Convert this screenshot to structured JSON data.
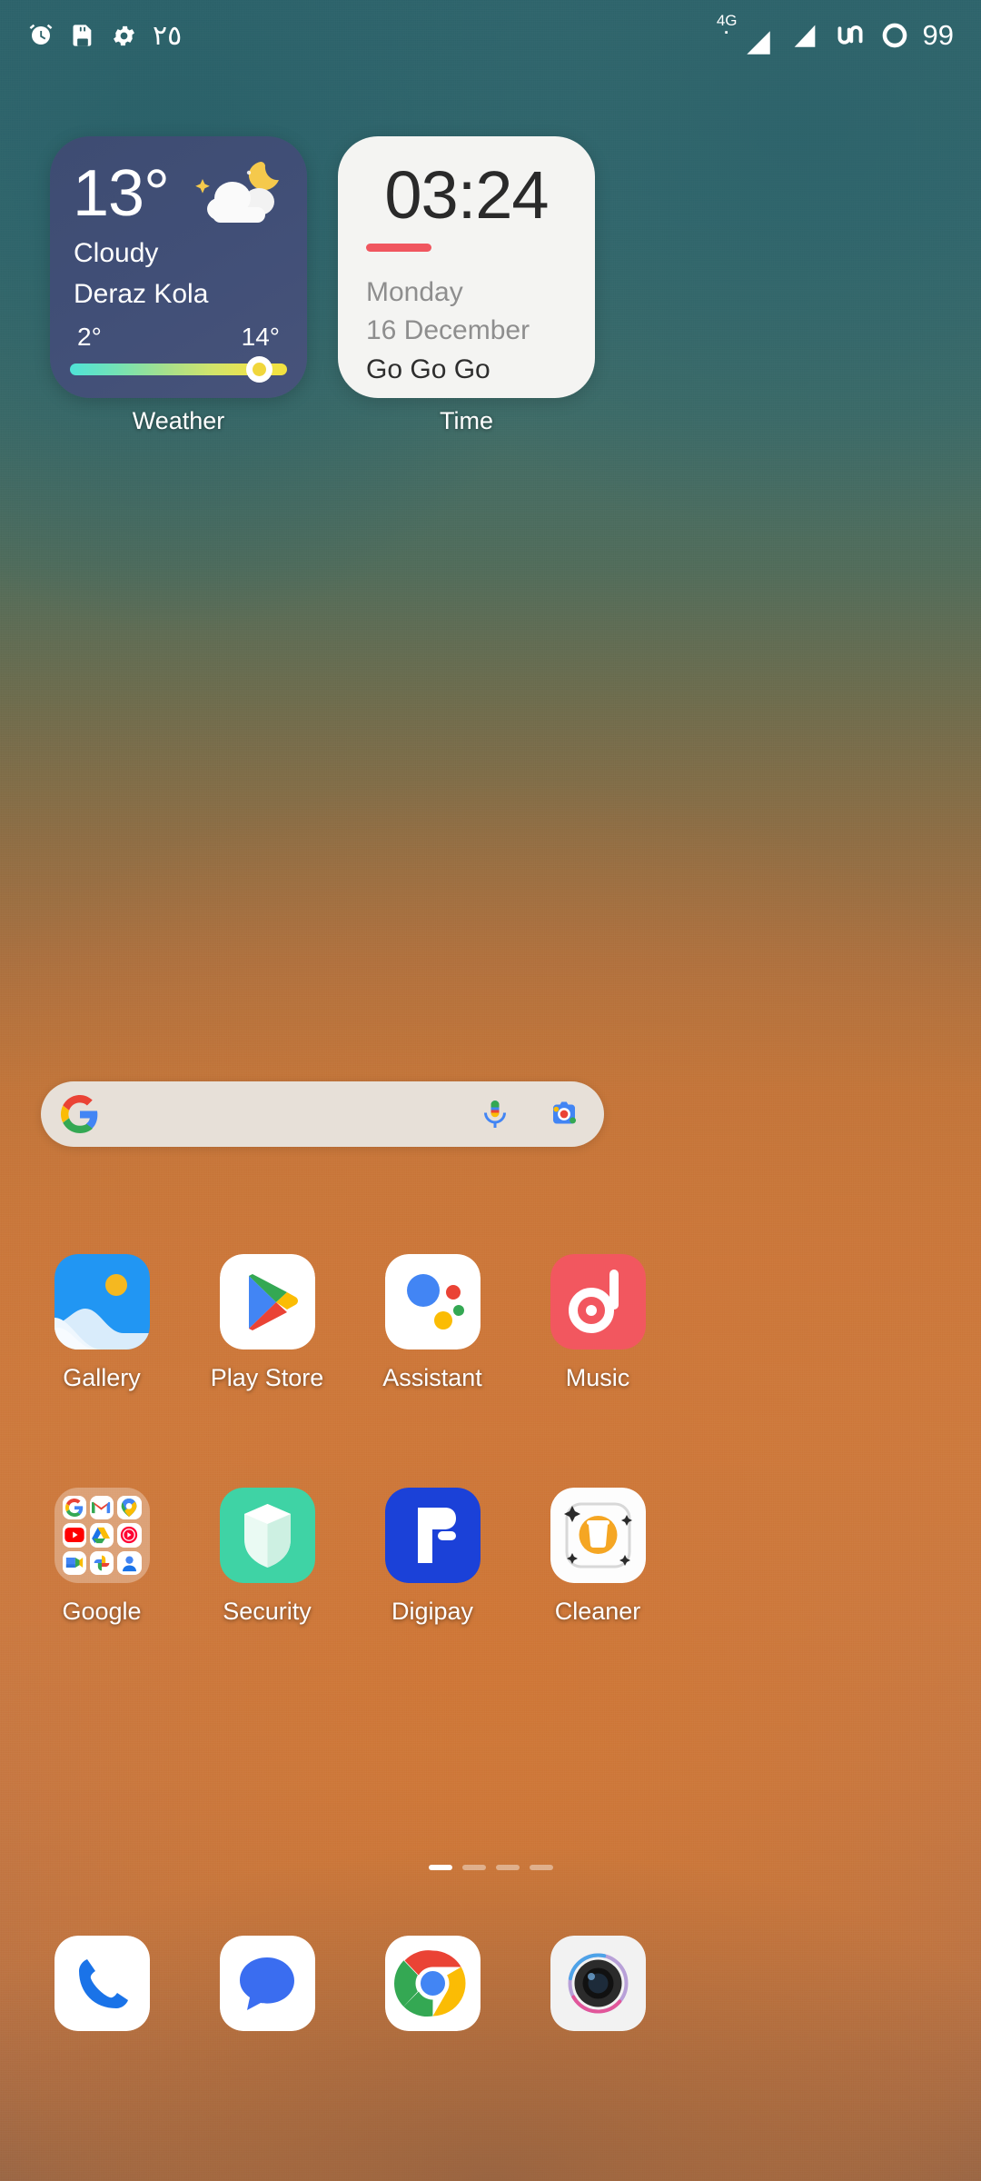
{
  "status_bar": {
    "left_icons": [
      "alarm-icon",
      "sd-card-icon",
      "settings-gear-icon"
    ],
    "notification_count": "٢٥",
    "network_type": "4G",
    "right_icons": [
      "signal-bars-icon",
      "signal-bars-2-icon",
      "vpn-icon",
      "battery-circle-icon"
    ],
    "battery_level": "99"
  },
  "widgets": {
    "weather": {
      "label": "Weather",
      "temperature": "13°",
      "condition": "Cloudy",
      "location": "Deraz Kola",
      "low": "2°",
      "high": "14°",
      "icon": "cloud-moon-icon"
    },
    "time": {
      "label": "Time",
      "clock": "03:24",
      "day": "Monday",
      "date": "16 December",
      "note": "Go Go Go"
    }
  },
  "search": {
    "name": "google-search-bar",
    "query": "",
    "placeholder": "",
    "logo": "google-g-icon",
    "mic": "microphone-icon",
    "lens": "google-lens-icon"
  },
  "apps": {
    "row1": [
      {
        "label": "Gallery",
        "icon": "gallery-icon"
      },
      {
        "label": "Play Store",
        "icon": "play-store-icon"
      },
      {
        "label": "Assistant",
        "icon": "google-assistant-icon"
      },
      {
        "label": "Music",
        "icon": "music-icon"
      }
    ],
    "row2": [
      {
        "label": "Google",
        "icon": "google-folder-icon"
      },
      {
        "label": "Security",
        "icon": "security-shield-icon"
      },
      {
        "label": "Digipay",
        "icon": "digipay-icon"
      },
      {
        "label": "Cleaner",
        "icon": "cleaner-icon"
      }
    ]
  },
  "folder_apps": [
    "google-icon",
    "gmail-icon",
    "maps-icon",
    "youtube-icon",
    "drive-icon",
    "youtube-music-icon",
    "meet-icon",
    "photos-icon",
    "contacts-icon"
  ],
  "dock": [
    {
      "label": "Phone",
      "icon": "phone-icon"
    },
    {
      "label": "Messages",
      "icon": "messages-icon"
    },
    {
      "label": "Chrome",
      "icon": "chrome-icon"
    },
    {
      "label": "Camera",
      "icon": "camera-icon"
    }
  ],
  "page_indicator": {
    "total": 4,
    "active": 1
  },
  "colors": {
    "weather_card": "#414f77",
    "time_card": "#f4f4f2",
    "time_accent": "#f0565f",
    "security_green": "#3fd3a5",
    "digipay_blue": "#1b41d8",
    "music_red": "#f2575f"
  }
}
